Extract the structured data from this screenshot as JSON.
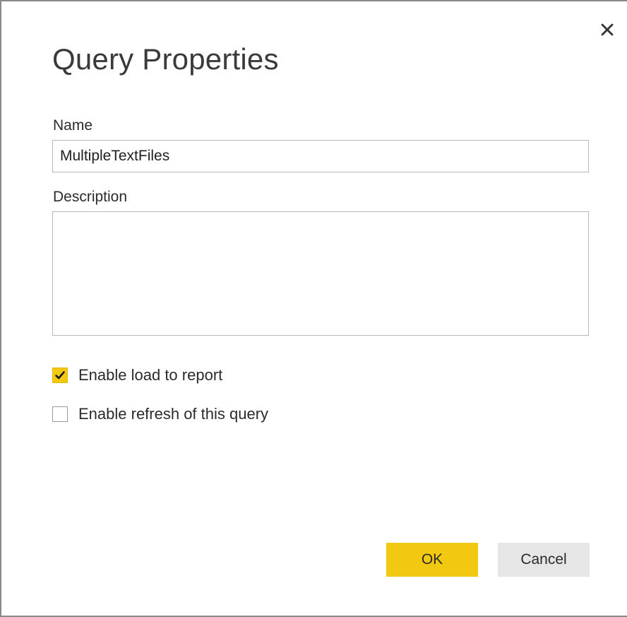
{
  "dialog": {
    "title": "Query Properties",
    "close_icon": "close-icon"
  },
  "name_field": {
    "label": "Name",
    "value": "MultipleTextFiles"
  },
  "description_field": {
    "label": "Description",
    "value": ""
  },
  "options": [
    {
      "label": "Enable load to report",
      "checked": true
    },
    {
      "label": "Enable refresh of this query",
      "checked": false
    }
  ],
  "buttons": {
    "ok_label": "OK",
    "cancel_label": "Cancel"
  },
  "colors": {
    "accent": "#f2c811",
    "cancel_bg": "#e6e6e6"
  }
}
